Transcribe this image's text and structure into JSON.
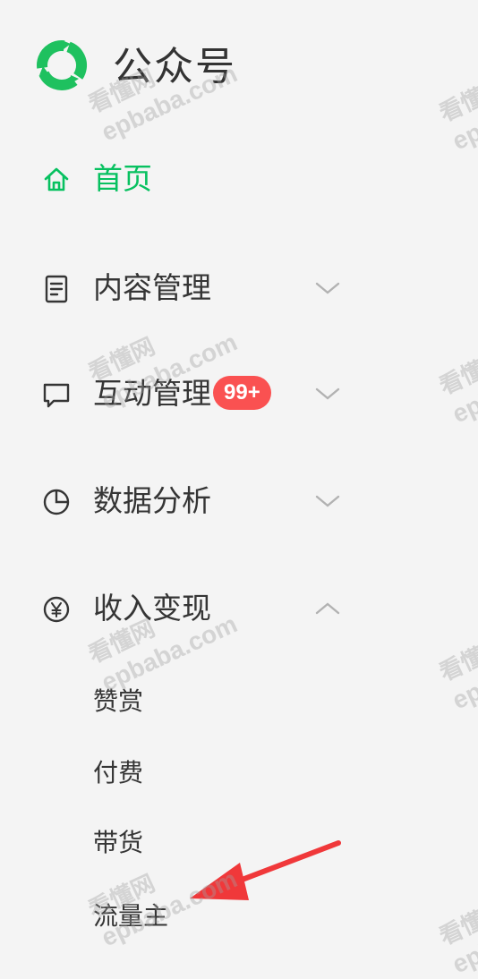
{
  "brand": {
    "name": "公众号"
  },
  "nav": {
    "home": {
      "label": "首页",
      "icon": "home-icon",
      "active": true
    },
    "content": {
      "label": "内容管理",
      "icon": "document-icon"
    },
    "interaction": {
      "label": "互动管理",
      "icon": "chat-bubble-icon",
      "badge": "99+"
    },
    "analytics": {
      "label": "数据分析",
      "icon": "pie-chart-icon"
    },
    "monetization": {
      "label": "收入变现",
      "icon": "yen-circle-icon",
      "expanded": true,
      "items": [
        {
          "label": "赞赏"
        },
        {
          "label": "付费"
        },
        {
          "label": "带货"
        },
        {
          "label": "流量主"
        }
      ]
    }
  },
  "watermark": {
    "line1": "看懂网",
    "line2": "epbaba.com"
  },
  "colors": {
    "accent": "#07c160",
    "badge": "#fa5151",
    "annotation_arrow": "#f0383a"
  }
}
